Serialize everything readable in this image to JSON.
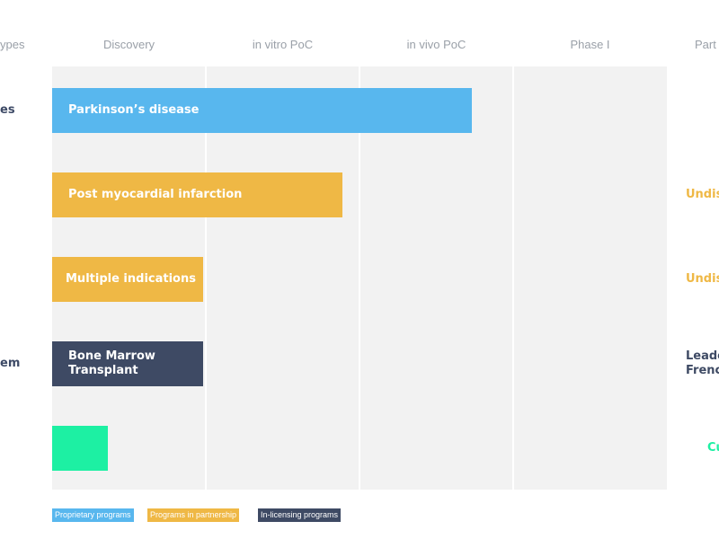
{
  "header": {
    "left_partial": "ypes",
    "right_partial": "Part"
  },
  "colors": {
    "proprietary": "#58b7ee",
    "partnership": "#efb845",
    "inlicensing": "#3e4a64",
    "cyan_green": "#1df0a3",
    "plot_bg": "#f2f2f2"
  },
  "chart_data": {
    "type": "bar",
    "orientation": "horizontal",
    "stages": [
      "Discovery",
      "in vitro PoC",
      "in vivo PoC",
      "Phase I"
    ],
    "programs": [
      {
        "label": "Parkinson’s disease",
        "progress": 2.73,
        "category": "proprietary",
        "left_label": "es",
        "right_label": ""
      },
      {
        "label": "Post myocardial infarction",
        "progress": 1.89,
        "category": "partnership",
        "left_label": "",
        "right_label": "Undis"
      },
      {
        "label": "Multiple indications",
        "progress": 0.98,
        "category": "partnership",
        "left_label": "",
        "right_label": "Undis"
      },
      {
        "label": "Bone Marrow\nTransplant",
        "progress": 0.98,
        "category": "inlicensing",
        "left_label": "em",
        "right_label": "Leade\nFrench"
      },
      {
        "label": "",
        "progress": 0.36,
        "category": "cyan_green",
        "left_label": "",
        "right_label": "Cu"
      }
    ],
    "legend": [
      {
        "label": "Proprietary programs",
        "category": "proprietary"
      },
      {
        "label": "Programs in partnership",
        "category": "partnership"
      },
      {
        "label": "In-licensing programs",
        "category": "inlicensing"
      }
    ]
  }
}
